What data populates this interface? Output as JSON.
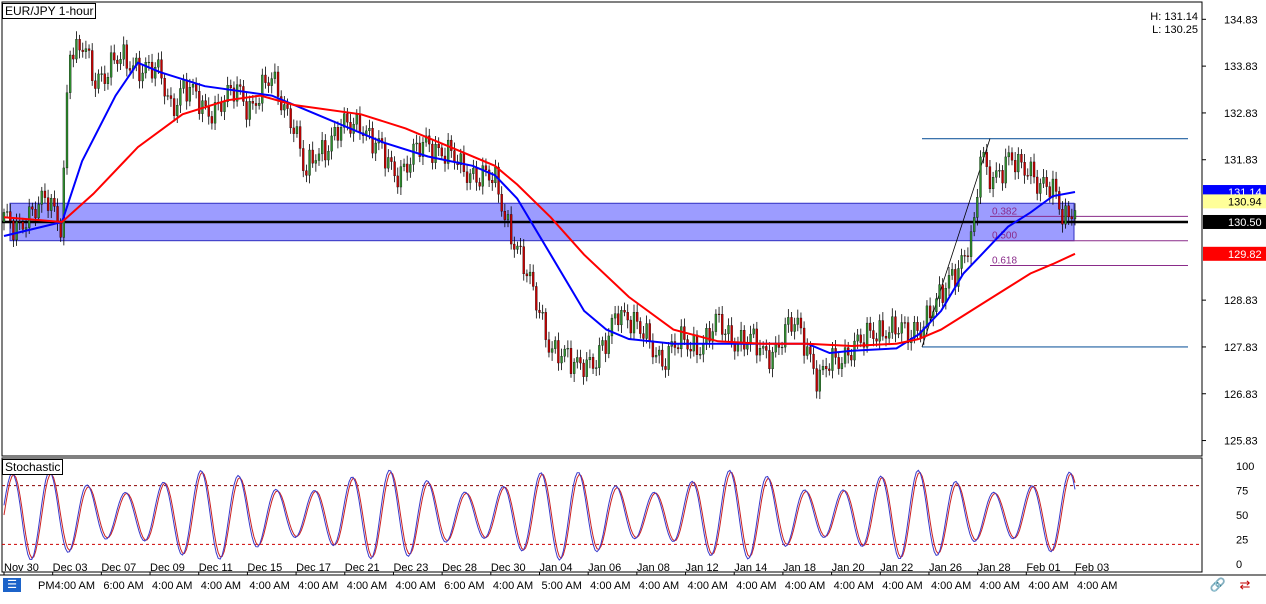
{
  "chart": {
    "title": "EUR/JPY 1-hour",
    "high_label": "H: 131.14",
    "low_label": "L: 130.25",
    "oscillator_title": "Stochastic"
  },
  "chart_data": {
    "type": "candlestick",
    "symbol": "EUR/JPY",
    "timeframe": "1-hour",
    "ylim": [
      125.5,
      135.2
    ],
    "y_ticks": [
      "134.83",
      "133.83",
      "132.83",
      "131.83",
      "128.83",
      "127.83",
      "126.83",
      "125.83"
    ],
    "x_date_labels": [
      "Nov 30",
      "Dec 03",
      "Dec 07",
      "Dec 09",
      "Dec 11",
      "Dec 15",
      "Dec 17",
      "Dec 21",
      "Dec 23",
      "Dec 28",
      "Dec 30",
      "Jan 04",
      "Jan 06",
      "Jan 08",
      "Jan 12",
      "Jan 14",
      "Jan 18",
      "Jan 20",
      "Jan 22",
      "Jan 26",
      "Jan 28",
      "Feb 01",
      "Feb 03"
    ],
    "x_time_labels": [
      "PM",
      "4:00 AM",
      "6:00 AM",
      "4:00 AM",
      "4:00 AM",
      "4:00 AM",
      "4:00 AM",
      "4:00 AM",
      "4:00 AM",
      "6:00 AM",
      "4:00 AM",
      "5:00 AM",
      "4:00 AM",
      "4:00 AM",
      "4:00 AM",
      "4:00 AM",
      "4:00 AM",
      "4:00 AM",
      "4:00 AM",
      "4:00 AM",
      "4:00 AM",
      "4:00 AM",
      "4:00 AM"
    ],
    "close_path": [
      {
        "t": 0,
        "v": 130.5
      },
      {
        "t": 0.5,
        "v": 130.3
      },
      {
        "t": 1,
        "v": 130.7
      },
      {
        "t": 2,
        "v": 130.9
      },
      {
        "t": 2.6,
        "v": 130.5
      },
      {
        "t": 2.9,
        "v": 134.3
      },
      {
        "t": 3.2,
        "v": 134.0
      },
      {
        "t": 3.6,
        "v": 134.2
      },
      {
        "t": 4,
        "v": 133.6
      },
      {
        "t": 4.5,
        "v": 133.7
      },
      {
        "t": 5,
        "v": 133.9
      },
      {
        "t": 5.5,
        "v": 133.9
      },
      {
        "t": 6,
        "v": 133.9
      },
      {
        "t": 7,
        "v": 133.6
      },
      {
        "t": 7.5,
        "v": 133.0
      },
      {
        "t": 8,
        "v": 133.4
      },
      {
        "t": 9,
        "v": 132.9
      },
      {
        "t": 10,
        "v": 133.1
      },
      {
        "t": 10.5,
        "v": 133.3
      },
      {
        "t": 11,
        "v": 133.0
      },
      {
        "t": 12,
        "v": 133.5
      },
      {
        "t": 12.5,
        "v": 133.1
      },
      {
        "t": 13,
        "v": 132.6
      },
      {
        "t": 13.5,
        "v": 131.4
      },
      {
        "t": 14,
        "v": 132.0
      },
      {
        "t": 14.5,
        "v": 132.2
      },
      {
        "t": 15,
        "v": 132.4
      },
      {
        "t": 16,
        "v": 132.7
      },
      {
        "t": 16.5,
        "v": 132.2
      },
      {
        "t": 17,
        "v": 131.9
      },
      {
        "t": 17.5,
        "v": 131.6
      },
      {
        "t": 18,
        "v": 131.7
      },
      {
        "t": 19,
        "v": 132.2
      },
      {
        "t": 19.5,
        "v": 132.1
      },
      {
        "t": 20,
        "v": 131.9
      },
      {
        "t": 20.5,
        "v": 131.6
      },
      {
        "t": 21,
        "v": 131.6
      },
      {
        "t": 21.5,
        "v": 131.5
      },
      {
        "t": 22,
        "v": 131.3
      },
      {
        "t": 22.5,
        "v": 130.6
      },
      {
        "t": 23,
        "v": 130.0
      },
      {
        "t": 23.5,
        "v": 129.2
      },
      {
        "t": 24,
        "v": 128.6
      },
      {
        "t": 24.5,
        "v": 127.9
      },
      {
        "t": 25,
        "v": 127.6
      },
      {
        "t": 25.5,
        "v": 127.4
      },
      {
        "t": 26,
        "v": 127.6
      },
      {
        "t": 26.5,
        "v": 127.5
      },
      {
        "t": 27,
        "v": 127.8
      },
      {
        "t": 27.5,
        "v": 128.7
      },
      {
        "t": 28,
        "v": 128.5
      },
      {
        "t": 28.5,
        "v": 128.1
      },
      {
        "t": 29,
        "v": 127.9
      },
      {
        "t": 29.5,
        "v": 127.6
      },
      {
        "t": 30,
        "v": 127.8
      },
      {
        "t": 30.5,
        "v": 127.9
      },
      {
        "t": 31,
        "v": 127.9
      },
      {
        "t": 31.5,
        "v": 128.0
      },
      {
        "t": 32,
        "v": 128.3
      },
      {
        "t": 32.5,
        "v": 128.1
      },
      {
        "t": 33,
        "v": 128.0
      },
      {
        "t": 33.5,
        "v": 127.9
      },
      {
        "t": 34,
        "v": 127.7
      },
      {
        "t": 34.5,
        "v": 127.8
      },
      {
        "t": 35,
        "v": 128.1
      },
      {
        "t": 35.5,
        "v": 128.3
      },
      {
        "t": 36,
        "v": 127.9
      },
      {
        "t": 36.5,
        "v": 127.1
      },
      {
        "t": 37,
        "v": 127.4
      },
      {
        "t": 37.5,
        "v": 127.6
      },
      {
        "t": 38,
        "v": 127.9
      },
      {
        "t": 38.5,
        "v": 127.9
      },
      {
        "t": 39,
        "v": 128.1
      },
      {
        "t": 39.5,
        "v": 128.3
      },
      {
        "t": 40,
        "v": 128.2
      },
      {
        "t": 40.5,
        "v": 128.0
      },
      {
        "t": 41,
        "v": 128.3
      },
      {
        "t": 41.5,
        "v": 128.6
      },
      {
        "t": 42,
        "v": 128.8
      },
      {
        "t": 42.5,
        "v": 129.4
      },
      {
        "t": 43,
        "v": 129.8
      },
      {
        "t": 43.5,
        "v": 130.3
      },
      {
        "t": 43.8,
        "v": 132.1
      },
      {
        "t": 44,
        "v": 131.5
      },
      {
        "t": 44.5,
        "v": 131.6
      },
      {
        "t": 45,
        "v": 131.8
      },
      {
        "t": 45.5,
        "v": 131.6
      },
      {
        "t": 46,
        "v": 131.7
      },
      {
        "t": 46.5,
        "v": 131.3
      },
      {
        "t": 47,
        "v": 131.1
      },
      {
        "t": 47.5,
        "v": 130.6
      },
      {
        "t": 48,
        "v": 130.94
      }
    ],
    "series": [
      {
        "name": "blue MA",
        "color": "#0000ff",
        "values": [
          {
            "t": 0,
            "v": 130.2
          },
          {
            "t": 2.6,
            "v": 130.5
          },
          {
            "t": 3.5,
            "v": 131.8
          },
          {
            "t": 5,
            "v": 133.2
          },
          {
            "t": 6,
            "v": 133.9
          },
          {
            "t": 7,
            "v": 133.7
          },
          {
            "t": 9,
            "v": 133.4
          },
          {
            "t": 12,
            "v": 133.2
          },
          {
            "t": 14,
            "v": 132.8
          },
          {
            "t": 17,
            "v": 132.2
          },
          {
            "t": 19,
            "v": 131.9
          },
          {
            "t": 21,
            "v": 131.7
          },
          {
            "t": 22,
            "v": 131.5
          },
          {
            "t": 23,
            "v": 131.0
          },
          {
            "t": 24.5,
            "v": 129.8
          },
          {
            "t": 26,
            "v": 128.6
          },
          {
            "t": 27,
            "v": 128.2
          },
          {
            "t": 28,
            "v": 128.0
          },
          {
            "t": 30,
            "v": 127.9
          },
          {
            "t": 34,
            "v": 127.9
          },
          {
            "t": 36,
            "v": 127.9
          },
          {
            "t": 37,
            "v": 127.7
          },
          {
            "t": 38,
            "v": 127.75
          },
          {
            "t": 40,
            "v": 127.8
          },
          {
            "t": 41,
            "v": 128.1
          },
          {
            "t": 42,
            "v": 128.6
          },
          {
            "t": 43,
            "v": 129.4
          },
          {
            "t": 44,
            "v": 129.9
          },
          {
            "t": 45,
            "v": 130.4
          },
          {
            "t": 46,
            "v": 130.7
          },
          {
            "t": 47,
            "v": 131.05
          },
          {
            "t": 48,
            "v": 131.14
          }
        ]
      },
      {
        "name": "red MA",
        "color": "#ff0000",
        "values": [
          {
            "t": 0,
            "v": 130.6
          },
          {
            "t": 2.6,
            "v": 130.5
          },
          {
            "t": 4,
            "v": 131.1
          },
          {
            "t": 6,
            "v": 132.1
          },
          {
            "t": 8,
            "v": 132.8
          },
          {
            "t": 10,
            "v": 133.1
          },
          {
            "t": 11.5,
            "v": 133.2
          },
          {
            "t": 13,
            "v": 133.0
          },
          {
            "t": 16,
            "v": 132.8
          },
          {
            "t": 18,
            "v": 132.5
          },
          {
            "t": 20,
            "v": 132.1
          },
          {
            "t": 22,
            "v": 131.7
          },
          {
            "t": 23,
            "v": 131.3
          },
          {
            "t": 24.5,
            "v": 130.6
          },
          {
            "t": 26,
            "v": 129.8
          },
          {
            "t": 28,
            "v": 128.9
          },
          {
            "t": 30,
            "v": 128.2
          },
          {
            "t": 32,
            "v": 127.95
          },
          {
            "t": 34,
            "v": 127.9
          },
          {
            "t": 36,
            "v": 127.9
          },
          {
            "t": 38,
            "v": 127.85
          },
          {
            "t": 40,
            "v": 127.9
          },
          {
            "t": 41,
            "v": 128.0
          },
          {
            "t": 42,
            "v": 128.2
          },
          {
            "t": 43,
            "v": 128.5
          },
          {
            "t": 44,
            "v": 128.8
          },
          {
            "t": 45,
            "v": 129.1
          },
          {
            "t": 46,
            "v": 129.4
          },
          {
            "t": 47,
            "v": 129.6
          },
          {
            "t": 48,
            "v": 129.82
          }
        ]
      }
    ],
    "horizontal_lines": [
      {
        "value": 130.5,
        "color": "#000000",
        "label": "130.50"
      },
      {
        "value": 132.28,
        "color": "#1f5fa0"
      },
      {
        "value": 127.83,
        "color": "#1f5fa0"
      }
    ],
    "support_zone": {
      "from": 130.1,
      "to": 130.9,
      "color": "#7b7bff"
    },
    "fibonacci": [
      {
        "label": "0.382",
        "value": 130.62
      },
      {
        "label": "0.500",
        "value": 130.1
      },
      {
        "label": "0.618",
        "value": 129.57
      }
    ],
    "price_labels": [
      {
        "text": "131.14",
        "value": 131.14,
        "color": "#0000ff"
      },
      {
        "text": "130.94",
        "value": 130.94,
        "color": "#000000"
      },
      {
        "text": "130.50",
        "value": 130.5,
        "color": "#000000"
      },
      {
        "text": "129.82",
        "value": 129.82,
        "color": "#ff0000"
      }
    ],
    "stochastic": {
      "ylim": [
        0,
        100
      ],
      "ticks": [
        "100",
        "75",
        "50",
        "25",
        "0"
      ],
      "levels": [
        80,
        20
      ]
    }
  }
}
